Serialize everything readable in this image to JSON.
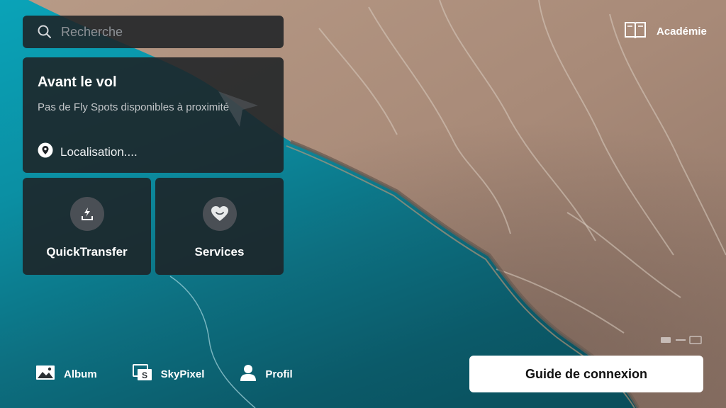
{
  "search": {
    "placeholder": "Recherche",
    "icon": "search-icon"
  },
  "avant_vol": {
    "title": "Avant le vol",
    "subtitle": "Pas de Fly Spots disponibles à proximité",
    "location": "Localisation...."
  },
  "tiles": [
    {
      "label": "QuickTransfer",
      "icon": "quicktransfer-icon"
    },
    {
      "label": "Services",
      "icon": "services-heart-icon"
    }
  ],
  "academie": {
    "label": "Académie",
    "icon": "book-icon"
  },
  "bottom_nav": [
    {
      "label": "Album",
      "icon": "album-icon"
    },
    {
      "label": "SkyPixel",
      "icon": "skypixel-icon"
    },
    {
      "label": "Profil",
      "icon": "profile-icon"
    }
  ],
  "guide_button": {
    "label": "Guide de connexion"
  },
  "colors": {
    "panel": "#1e2226",
    "accent_white": "#ffffff",
    "water": "#0aa3b8",
    "land": "#b08f7c"
  }
}
